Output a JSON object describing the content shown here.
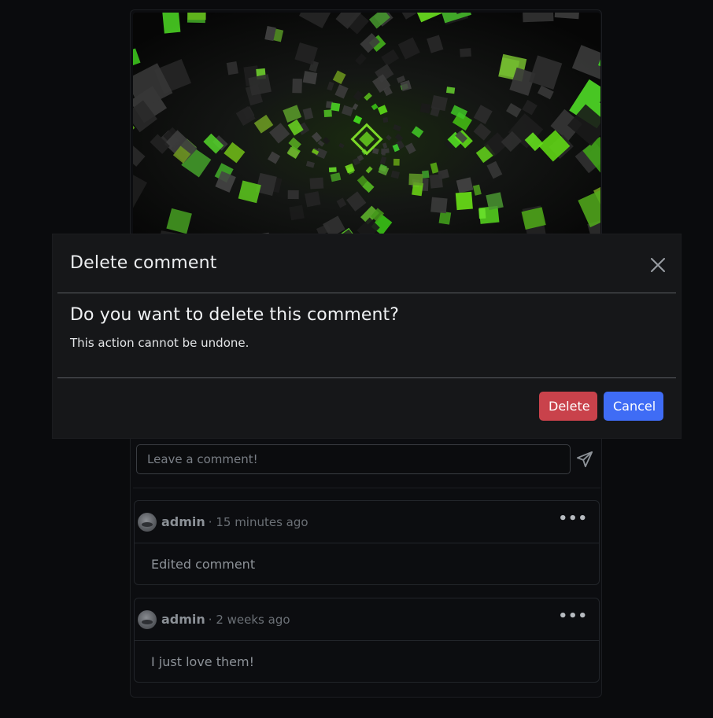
{
  "modal": {
    "title": "Delete comment",
    "question": "Do you want to delete this comment?",
    "note": "This action cannot be undone.",
    "delete_label": "Delete",
    "cancel_label": "Cancel"
  },
  "comment_form": {
    "placeholder": "Leave a comment!"
  },
  "comments": [
    {
      "author": "admin",
      "time": "· 15 minutes ago",
      "text": "Edited comment"
    },
    {
      "author": "admin",
      "time": "· 2 weeks ago",
      "text": "I just love them!"
    }
  ],
  "colors": {
    "delete": "#c9424b",
    "cancel": "#3f6cf5",
    "accent_green": "#6fd11f"
  },
  "icons": {
    "close": "close-icon",
    "send": "paper-plane-icon",
    "menu": "more-horizontal-icon"
  }
}
